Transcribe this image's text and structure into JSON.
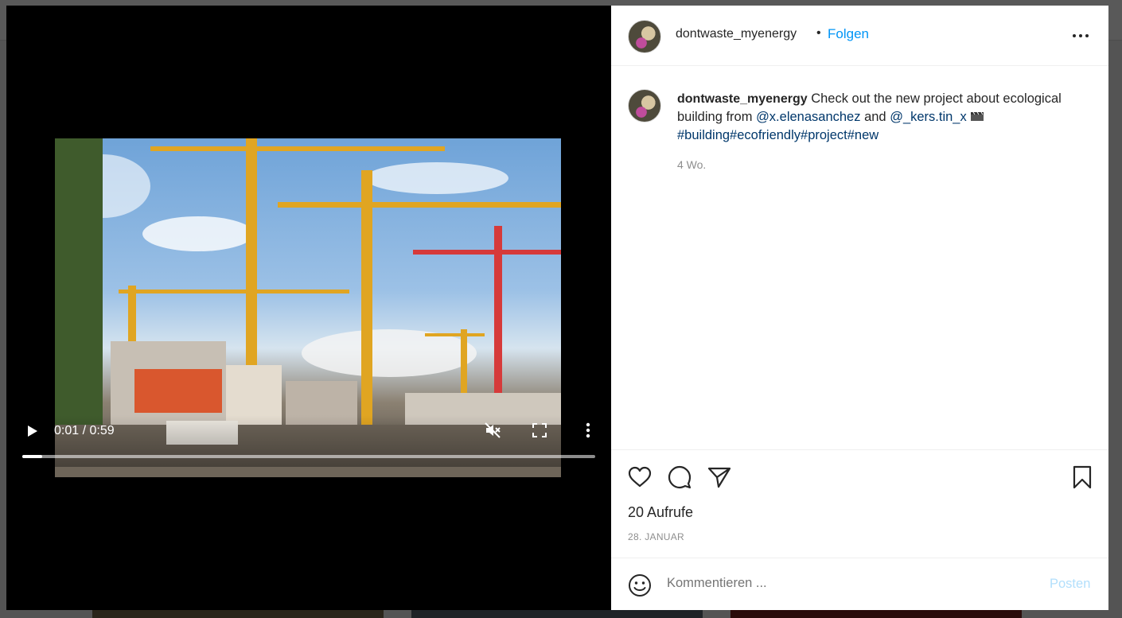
{
  "video": {
    "time": "0:01 / 0:59",
    "progress": 0.017
  },
  "post": {
    "username": "dontwaste_myenergy",
    "follow_label": "Folgen",
    "separator": "•",
    "caption_text": "Check out the new project about ecological building from",
    "mention_1": "@x.elenasanchez",
    "caption_and": "and",
    "mention_2": "@_kers.tin_x",
    "hashtags": "#building#ecofriendly#project#new",
    "age": "4 Wo.",
    "views": "20 Aufrufe",
    "date": "28. JANUAR"
  },
  "comment": {
    "placeholder": "Kommentieren ...",
    "post_label": "Posten"
  },
  "colors": {
    "accent": "#0095f6",
    "link": "#00376b",
    "muted": "#8e8e8e",
    "post_disabled": "#b2dffc"
  }
}
